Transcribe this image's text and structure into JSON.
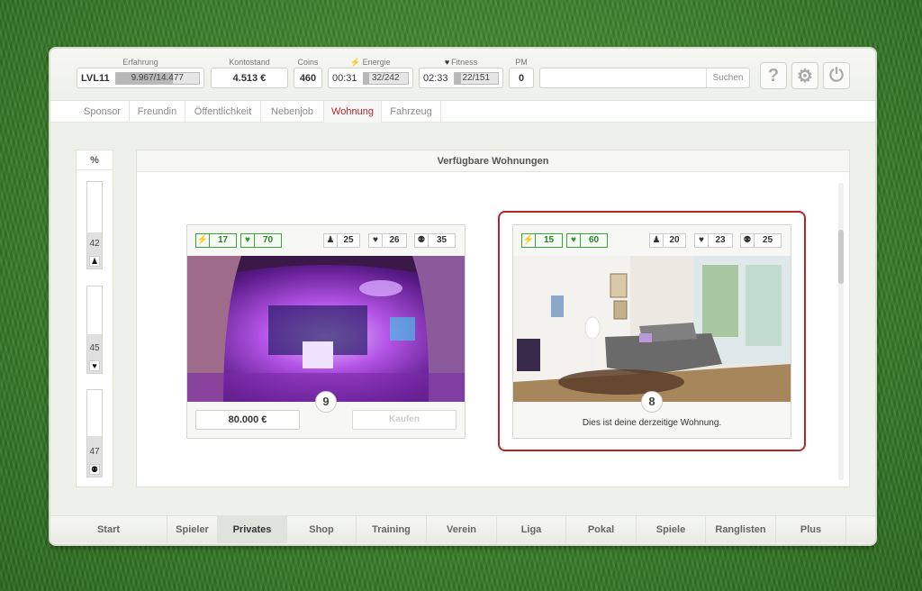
{
  "header": {
    "level": "LVL11",
    "experience": {
      "label": "Erfahrung",
      "text": "9.967/14.477",
      "progress": 0.69
    },
    "balance": {
      "label": "Kontostand",
      "value": "4.513 €"
    },
    "coins": {
      "label": "Coins",
      "value": "460"
    },
    "energy": {
      "label": "Energie",
      "timer": "00:31",
      "text": "32/242",
      "progress": 0.13
    },
    "fitness": {
      "label": "Fitness",
      "timer": "02:33",
      "text": "22/151",
      "progress": 0.15
    },
    "pm": {
      "label": "PM",
      "value": "0"
    },
    "search": {
      "placeholder": "",
      "button": "Suchen"
    },
    "icons": {
      "help": "?",
      "settings": "⚙",
      "power": "⏻"
    }
  },
  "subnav": [
    "Sponsor",
    "Freundin",
    "Öffentlichkeit",
    "Nebenjob",
    "Wohnung",
    "Fahrzeug"
  ],
  "subnav_active": "Wohnung",
  "sidebar": {
    "header": "%",
    "bars": [
      {
        "value": "42",
        "fill": 0.42,
        "icon": "person-icon"
      },
      {
        "value": "45",
        "fill": 0.45,
        "icon": "hearts-icon"
      },
      {
        "value": "47",
        "fill": 0.47,
        "icon": "couple-icon"
      }
    ]
  },
  "panel": {
    "title": "Verfügbare Wohnungen",
    "apartments": [
      {
        "energy": "17",
        "fitness": "70",
        "stat_person": "25",
        "stat_hearts": "26",
        "stat_couple": "35",
        "number": "9",
        "price": "80.000 €",
        "buy_label": "Kaufen",
        "current": false
      },
      {
        "energy": "15",
        "fitness": "60",
        "stat_person": "20",
        "stat_hearts": "23",
        "stat_couple": "25",
        "number": "8",
        "caption": "Dies ist deine derzeitige Wohnung.",
        "current": true
      }
    ]
  },
  "bottomnav": [
    "Start",
    "Spieler",
    "Privates",
    "Shop",
    "Training",
    "Verein",
    "Liga",
    "Pokal",
    "Spiele",
    "Ranglisten",
    "Plus"
  ],
  "bottomnav_active": "Privates",
  "colors": {
    "accent": "#b5252a",
    "green": "#3aa53a"
  }
}
